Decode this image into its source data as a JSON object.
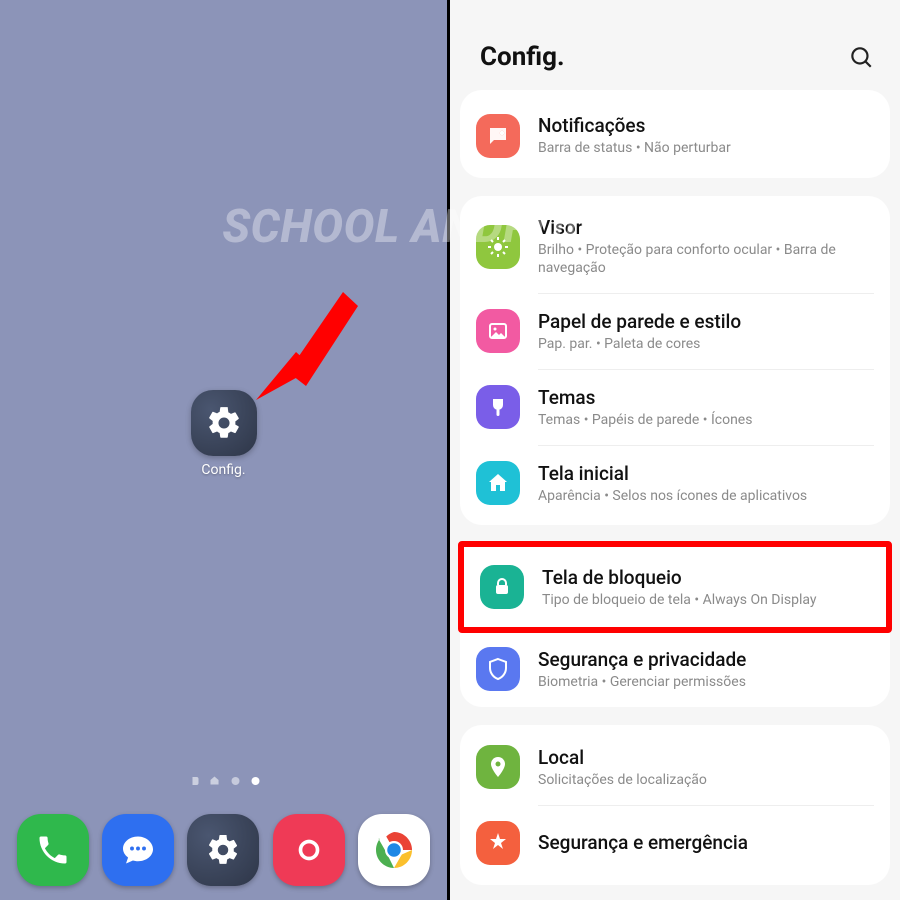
{
  "watermark": "SCHOOL ANDROID BR",
  "homescreen": {
    "app_label": "Config.",
    "dock": {
      "phone": "phone",
      "messages": "messages",
      "settings": "settings",
      "camera": "camera",
      "chrome": "chrome"
    }
  },
  "settings": {
    "title": "Config.",
    "items": [
      {
        "title": "Notificações",
        "sub": "Barra de status  •  Não perturbar",
        "icon": "notif"
      },
      {
        "title": "Visor",
        "sub": "Brilho  •  Proteção para conforto ocular  •  Barra de navegação",
        "icon": "display"
      },
      {
        "title": "Papel de parede e estilo",
        "sub": "Pap. par.  •  Paleta de cores",
        "icon": "wallpaper"
      },
      {
        "title": "Temas",
        "sub": "Temas  •  Papéis de parede  •  Ícones",
        "icon": "themes"
      },
      {
        "title": "Tela inicial",
        "sub": "Aparência  •  Selos nos ícones de aplicativos",
        "icon": "home"
      },
      {
        "title": "Tela de bloqueio",
        "sub": "Tipo de bloqueio de tela  •  Always On Display",
        "icon": "lock",
        "highlighted": true
      },
      {
        "title": "Segurança e privacidade",
        "sub": "Biometria  •  Gerenciar permissões",
        "icon": "security"
      },
      {
        "title": "Local",
        "sub": "Solicitações de localização",
        "icon": "location"
      },
      {
        "title": "Segurança e emergência",
        "sub": "",
        "icon": "emergency"
      }
    ]
  }
}
